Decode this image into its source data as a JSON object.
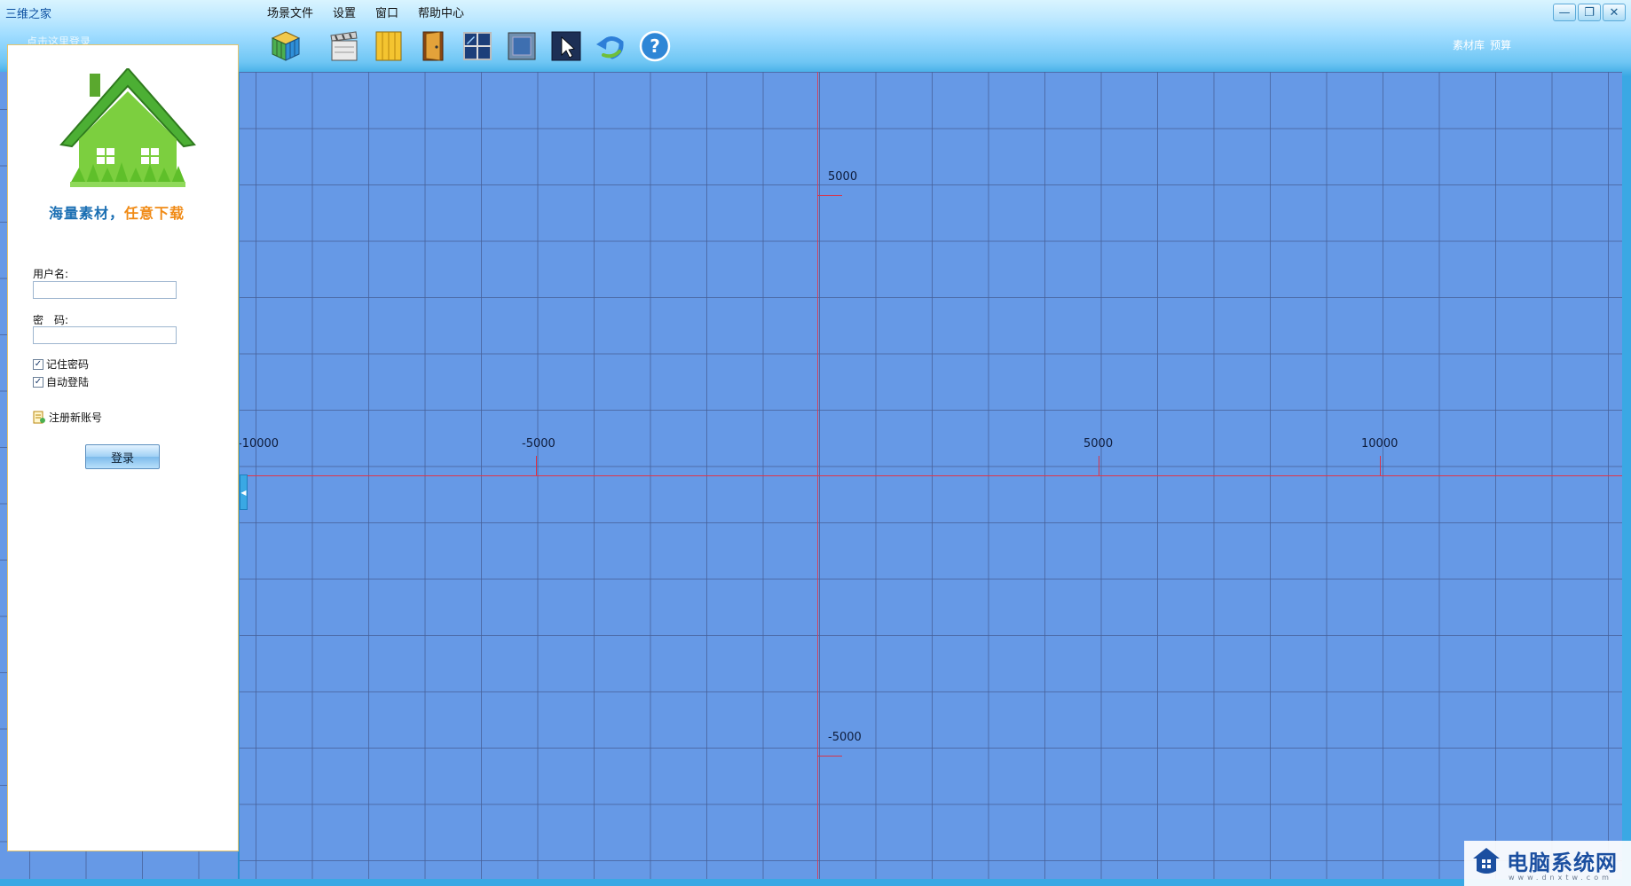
{
  "window": {
    "title": "三维之家",
    "subtitle": "点击这里登录",
    "minimize": "—",
    "maximize": "❐",
    "close": "✕"
  },
  "menu": {
    "items": [
      "场景文件",
      "设置",
      "窗口",
      "帮助中心"
    ]
  },
  "top_right": {
    "links": [
      "素材库",
      "预算"
    ]
  },
  "toolbar": {
    "buttons": [
      "cube-3d-icon",
      "clapper-icon",
      "wood-floor-icon",
      "door-icon",
      "window-icon",
      "frame-icon",
      "select-arrow-icon",
      "undo-icon",
      "help-icon"
    ]
  },
  "login": {
    "slogan_part1": "海量素材，",
    "slogan_part2": "任意下载",
    "username_label": "用户名:",
    "username_value": "",
    "password_label": "密　码:",
    "password_value": "",
    "remember_label": "记住密码",
    "remember_checked": true,
    "autologin_label": "自动登陆",
    "autologin_checked": true,
    "register_label": "注册新账号",
    "login_button": "登录",
    "collapse_glyph": "◀"
  },
  "canvas": {
    "x_labels": [
      "-10000",
      "-5000",
      "5000",
      "10000"
    ],
    "y_labels": [
      "5000",
      "-5000"
    ],
    "background_color": "#6699e6",
    "axis_color": "#e0364a"
  },
  "watermark": {
    "text": "电脑系统网",
    "url": "www.dnxtw.com"
  }
}
